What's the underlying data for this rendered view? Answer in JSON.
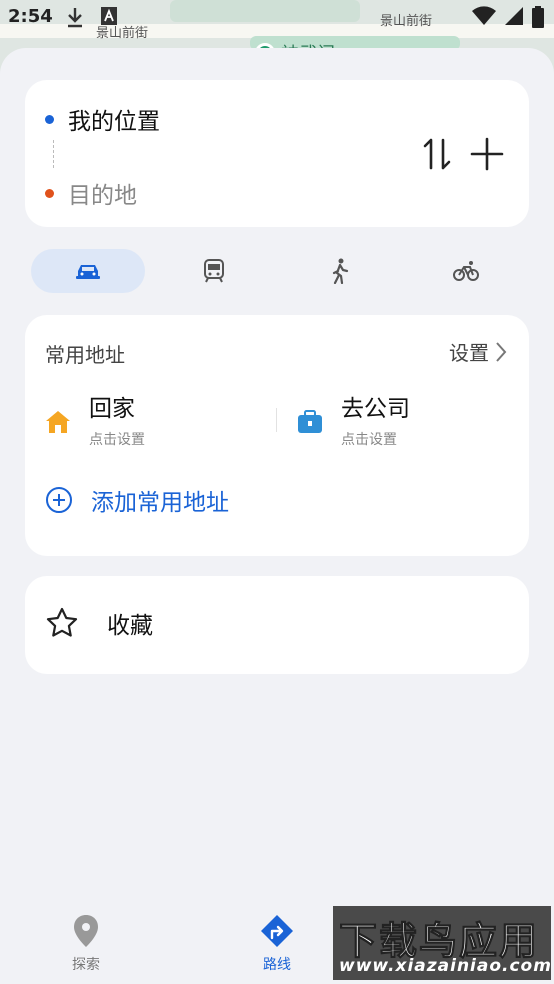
{
  "status": {
    "time": "2:54"
  },
  "map": {
    "street_left": "景山前街",
    "street_right": "景山前街",
    "metro": "神武门"
  },
  "route": {
    "origin": "我的位置",
    "destination": "目的地"
  },
  "modes": [
    {
      "name": "car",
      "active": true
    },
    {
      "name": "bus",
      "active": false
    },
    {
      "name": "walk",
      "active": false
    },
    {
      "name": "bike",
      "active": false
    }
  ],
  "favorites": {
    "title": "常用地址",
    "settings_label": "设置",
    "home": {
      "name": "回家",
      "sub": "点击设置"
    },
    "work": {
      "name": "去公司",
      "sub": "点击设置"
    },
    "add_label": "添加常用地址"
  },
  "collect": {
    "label": "收藏"
  },
  "nav": {
    "explore": "探索",
    "route": "路线"
  },
  "watermark": {
    "title": "下载鸟应用",
    "url": "www.xiazainiao.com"
  },
  "colors": {
    "accent": "#1a63d6",
    "origin_dot": "#1a63d6",
    "dest_dot": "#e0521c",
    "home_icon": "#f5a623",
    "work_icon": "#2f8fd6"
  }
}
